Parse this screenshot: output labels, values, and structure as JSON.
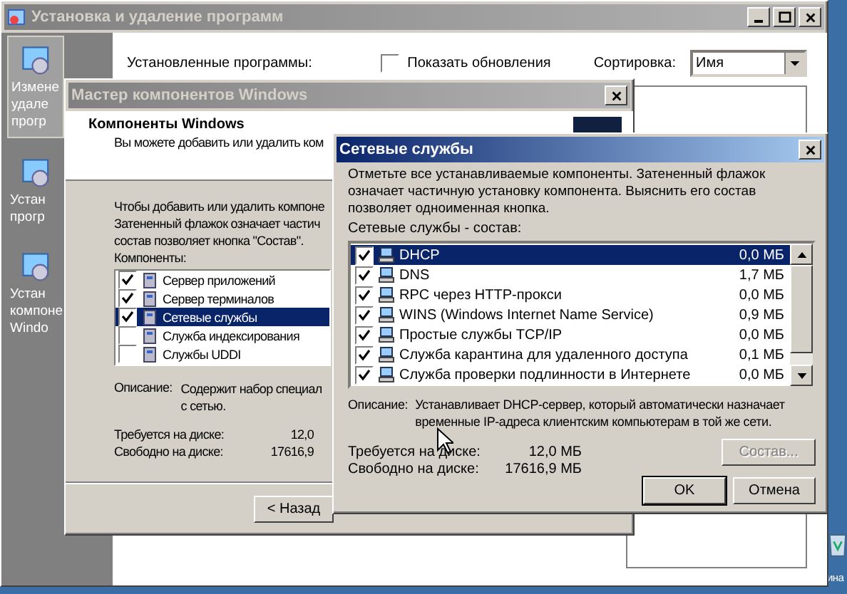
{
  "main_window": {
    "title": "Установка и удаление программ",
    "sidebar": [
      {
        "lines": [
          "Измене",
          "удале",
          "прогр"
        ],
        "selected": true
      },
      {
        "lines": [
          "Устан",
          "прогр"
        ],
        "selected": false
      },
      {
        "lines": [
          "Устан",
          "компоне",
          "Windo"
        ],
        "selected": false
      }
    ],
    "installed_label": "Установленные программы:",
    "show_updates": {
      "label": "Показать обновления",
      "checked": false
    },
    "sort": {
      "label": "Сортировка:",
      "value": "Имя"
    }
  },
  "desktop_icon_label": "ина",
  "wizard": {
    "title": "Мастер компонентов Windows",
    "header_title": "Компоненты Windows",
    "header_subtitle": "Вы можете добавить или удалить ком",
    "intro_lines": [
      "Чтобы добавить или удалить компоне",
      "Затененный флажок означает частич",
      "состав позволяет кнопка \"Состав\"."
    ],
    "components_label": "Компоненты:",
    "components": [
      {
        "name": "Сервер приложений",
        "checked": true,
        "selected": false
      },
      {
        "name": "Сервер терминалов",
        "checked": true,
        "selected": false
      },
      {
        "name": "Сетевые службы",
        "checked": true,
        "selected": true
      },
      {
        "name": "Служба индексирования",
        "checked": false,
        "selected": false
      },
      {
        "name": "Службы UDDI",
        "checked": false,
        "selected": false
      }
    ],
    "description_label": "Описание:",
    "description_lines": [
      "Содержит набор специал",
      "с сетью."
    ],
    "required_label": "Требуется на диске:",
    "required_value": "12,0",
    "free_label": "Свободно на диске:",
    "free_value": "17616,9",
    "back_button": "< Назад"
  },
  "dialog": {
    "title": "Сетевые службы",
    "intro": "Отметьте все устанавливаемые компоненты. Затененный флажок означает частичную установку компонента. Выяснить его состав позволяет одноименная кнопка.",
    "list_label": "Сетевые службы - состав:",
    "items": [
      {
        "name": "DHCP",
        "size": "0,0 МБ",
        "checked": true,
        "selected": true
      },
      {
        "name": "DNS",
        "size": "1,7 МБ",
        "checked": true,
        "selected": false
      },
      {
        "name": "RPC через HTTP-прокси",
        "size": "0,0 МБ",
        "checked": true,
        "selected": false
      },
      {
        "name": "WINS (Windows Internet Name Service)",
        "size": "0,9 МБ",
        "checked": true,
        "selected": false
      },
      {
        "name": "Простые службы TCP/IP",
        "size": "0,0 МБ",
        "checked": true,
        "selected": false
      },
      {
        "name": "Служба карантина для удаленного доступа",
        "size": "0,1 МБ",
        "checked": true,
        "selected": false
      },
      {
        "name": "Служба проверки подлинности в Интернете",
        "size": "0,0 МБ",
        "checked": true,
        "selected": false
      }
    ],
    "description_label": "Описание:",
    "description": "Устанавливает DHCP-сервер, который автоматически назначает временные IP-адреса клиентским компьютерам в той же сети.",
    "required_label": "Требуется на диске:",
    "required_value": "12,0 МБ",
    "free_label": "Свободно на диске:",
    "free_value": "17616,9 МБ",
    "details_button": {
      "label": "Состав...",
      "disabled": true
    },
    "ok_button": "OK",
    "cancel_button": "Отмена"
  }
}
